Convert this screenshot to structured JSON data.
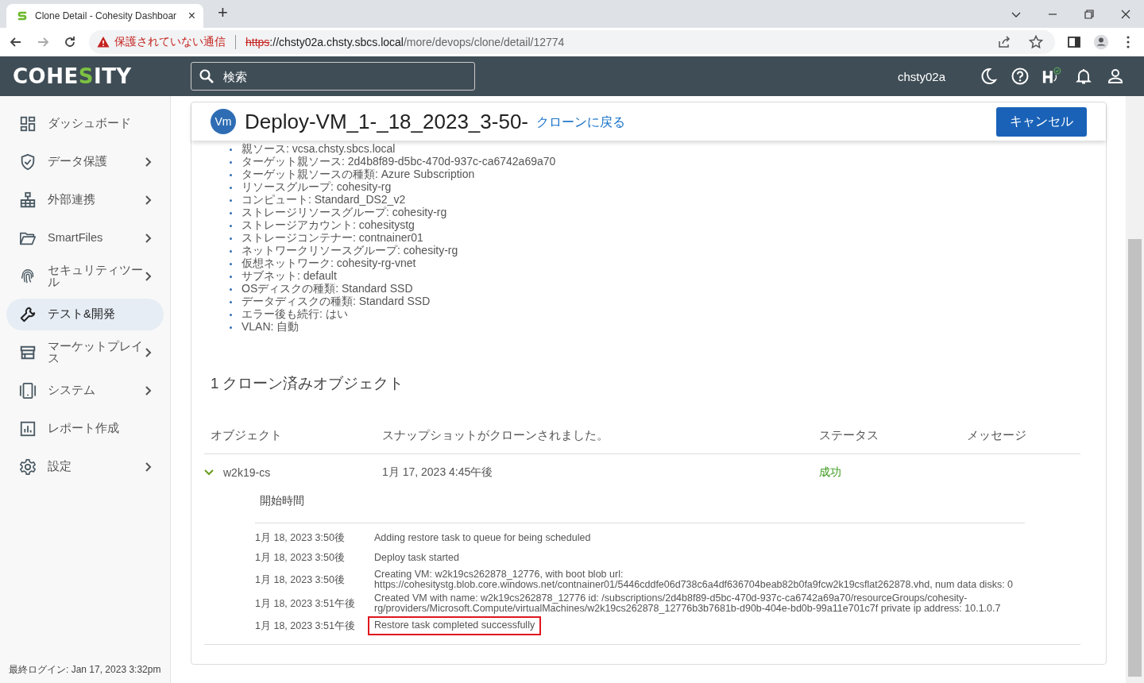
{
  "browser": {
    "tab_title": "Clone Detail - Cohesity Dashboar",
    "tab_close": "×",
    "new_tab": "+",
    "security_label": "保護されていない通信",
    "url_scheme": "https",
    "url_rest": "://chsty02a.chsty.sbcs.local",
    "url_path": "/more/devops/clone/detail/12774"
  },
  "header": {
    "logo_left": "COHE",
    "logo_accent": "S",
    "logo_right": "ITY",
    "search": {
      "placeholder": "検索"
    },
    "cluster": "chsty02a"
  },
  "sidebar": {
    "items": [
      {
        "label": "ダッシュボード",
        "expandable": false,
        "selected": false
      },
      {
        "label": "データ保護",
        "expandable": true,
        "selected": false
      },
      {
        "label": "外部連携",
        "expandable": true,
        "selected": false
      },
      {
        "label": "SmartFiles",
        "expandable": true,
        "selected": false
      },
      {
        "label": "セキュリティツール",
        "expandable": true,
        "selected": false
      },
      {
        "label": "テスト&開発",
        "expandable": false,
        "selected": true
      },
      {
        "label": "マーケットプレイス",
        "expandable": true,
        "selected": false
      },
      {
        "label": "システム",
        "expandable": true,
        "selected": false
      },
      {
        "label": "レポート作成",
        "expandable": false,
        "selected": false
      },
      {
        "label": "設定",
        "expandable": true,
        "selected": false
      }
    ],
    "last_login": "最終ログイン: Jan 17, 2023 3:32pm"
  },
  "clone": {
    "avatar": "Vm",
    "title": "Deploy-VM_1-_18_2023_3-50-",
    "back_link": "クローンに戻る",
    "cancel_button": "キャンセル",
    "details": [
      "親ソース: vcsa.chsty.sbcs.local",
      "ターゲット親ソース: 2d4b8f89-d5bc-470d-937c-ca6742a69a70",
      "ターゲット親ソースの種類: Azure Subscription",
      "リソースグループ: cohesity-rg",
      "コンピュート: Standard_DS2_v2",
      "ストレージリソースグループ: cohesity-rg",
      "ストレージアカウント: cohesitystg",
      "ストレージコンテナー: contnainer01",
      "ネットワークリソースグループ: cohesity-rg",
      "仮想ネットワーク: cohesity-rg-vnet",
      "サブネット: default",
      "OSディスクの種類: Standard SSD",
      "データディスクの種類: Standard SSD",
      "エラー後も続行: はい",
      "VLAN: 自動"
    ],
    "objects_heading": "1 クローン済みオブジェクト",
    "columns": [
      "オブジェクト",
      "スナップショットがクローンされました。",
      "ステータス",
      "メッセージ"
    ],
    "rows": [
      {
        "object": "w2k19-cs",
        "expanded": true,
        "snapshot": "1月 17, 2023 4:45午後",
        "status": "成功",
        "log_column": "開始時間",
        "log": [
          {
            "time": "1月 18, 2023 3:50後",
            "message": "Adding restore task to queue for being scheduled",
            "highlighted": false
          },
          {
            "time": "1月 18, 2023 3:50後",
            "message": "Deploy task started",
            "highlighted": false
          },
          {
            "time": "1月 18, 2023 3:50後",
            "message": "Creating VM: w2k19cs262878_12776, with boot blob url: https://cohesitystg.blob.core.windows.net/contnainer01/5446cddfe06d738c6a4df636704beab82b0fa9fcw2k19csflat262878.vhd, num data disks: 0",
            "highlighted": false
          },
          {
            "time": "1月 18, 2023 3:51午後",
            "message": "Created VM with name: w2k19cs262878_12776 id: /subscriptions/2d4b8f89-d5bc-470d-937c-ca6742a69a70/resourceGroups/cohesity-rg/providers/Microsoft.Compute/virtualMachines/w2k19cs262878_12776b3b7681b-d90b-404e-bd0b-99a11e701c7f private ip address: 10.1.0.7",
            "highlighted": false
          },
          {
            "time": "1月 18, 2023 3:51午後",
            "message": "Restore task completed successfully",
            "highlighted": true
          }
        ]
      }
    ]
  }
}
